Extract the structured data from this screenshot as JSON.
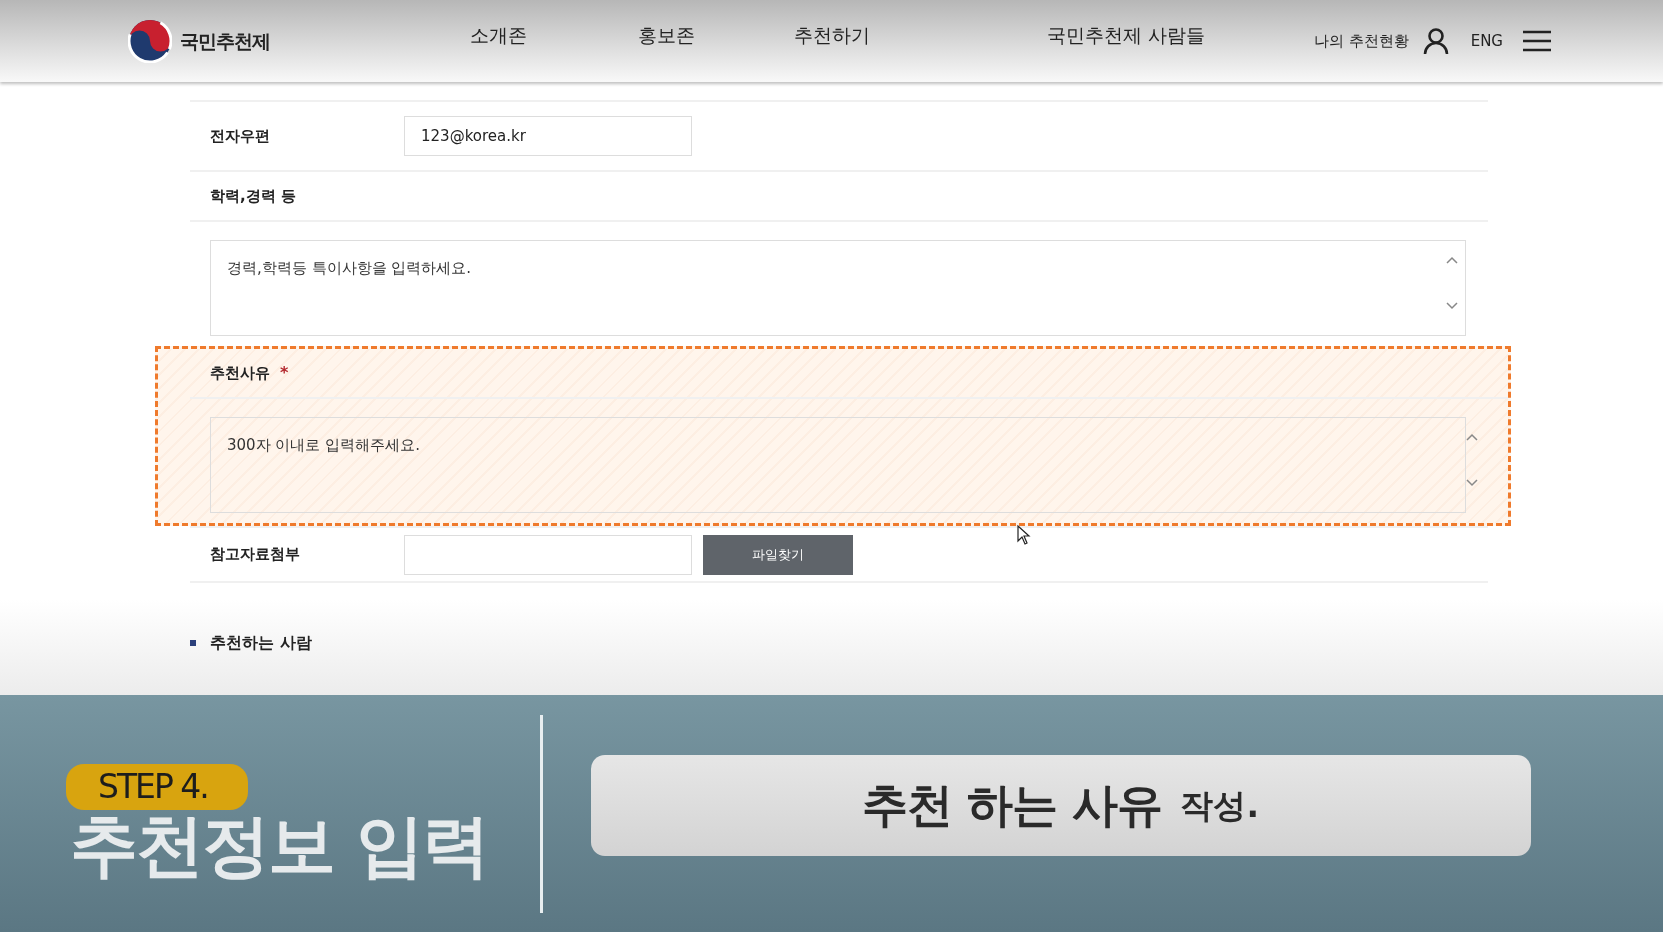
{
  "header": {
    "logo_text": "국민추천제",
    "nav": [
      {
        "label": "소개존"
      },
      {
        "label": "홍보존"
      },
      {
        "label": "추천하기"
      },
      {
        "label": "국민추천제 사람들"
      }
    ],
    "my_status": "나의 추천현황",
    "language": "ENG"
  },
  "form": {
    "sections": [
      {
        "highlighted": false,
        "rows": [
          {
            "kind": "input",
            "label": "전자우편",
            "value": "123@korea.kr"
          },
          {
            "kind": "heading",
            "label": "학력,경력 등"
          },
          {
            "kind": "textarea",
            "placeholder": "경력,학력등 특이사항을 입력하세요."
          }
        ]
      },
      {
        "highlighted": true,
        "rows": [
          {
            "kind": "heading",
            "label": "추천사유",
            "required": true,
            "mark": "*"
          },
          {
            "kind": "textarea",
            "placeholder": "300자 이내로 입력해주세요."
          }
        ]
      },
      {
        "highlighted": false,
        "rows": [
          {
            "kind": "file",
            "label": "참고자료첨부",
            "button": "파일찾기"
          }
        ]
      }
    ],
    "next_section": "추천하는 사람"
  },
  "caption": {
    "step": "STEP 4.",
    "title": "추천정보 입력",
    "box_main": "추천 하는 사유",
    "box_suffix": "작성."
  }
}
